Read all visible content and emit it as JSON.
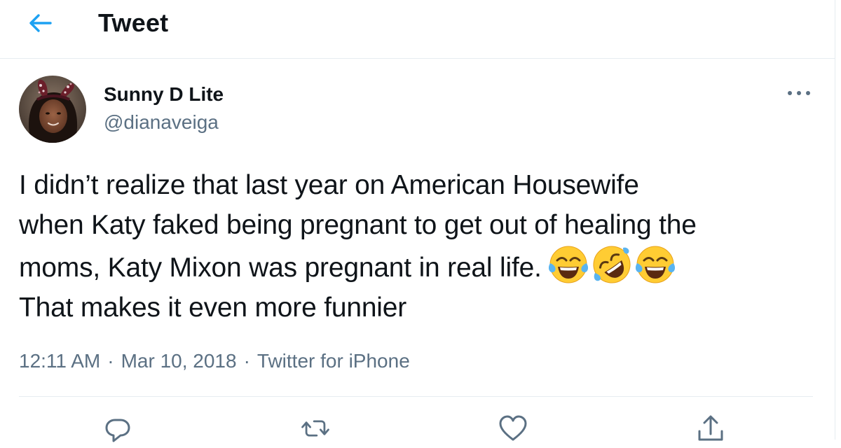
{
  "header": {
    "title": "Tweet",
    "back_icon": "arrow-left-icon",
    "accent_color": "#1da1f2"
  },
  "tweet": {
    "author": {
      "display_name": "Sunny D Lite",
      "handle": "@dianaveiga"
    },
    "more_icon": "more-dots-icon",
    "text_line_1": "I didn’t realize that last year on American Housewife",
    "text_line_2": "when Katy faked being pregnant to get out of healing the",
    "text_line_3": "moms, Katy Mixon was pregnant in real life.",
    "text_line_4": "That makes it even more funnier",
    "emojis": [
      "face-with-tears-of-joy",
      "rolling-on-the-floor-laughing",
      "face-with-tears-of-joy"
    ],
    "time": "12:11 AM",
    "date": "Mar 10, 2018",
    "source": "Twitter for iPhone",
    "separator": "·"
  },
  "actions": {
    "reply_icon": "reply-icon",
    "retweet_icon": "retweet-icon",
    "like_icon": "heart-icon",
    "share_icon": "share-icon"
  },
  "colors": {
    "text_primary": "#0f1419",
    "text_secondary": "#5b7083",
    "border": "#e6ecf0"
  }
}
